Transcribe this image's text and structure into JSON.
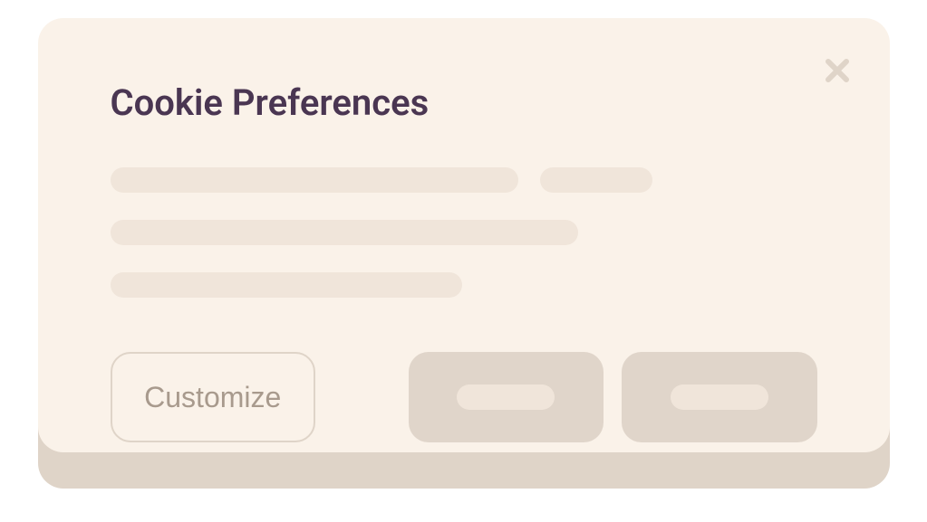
{
  "modal": {
    "title": "Cookie Preferences",
    "buttons": {
      "customize_label": "Customize"
    }
  }
}
